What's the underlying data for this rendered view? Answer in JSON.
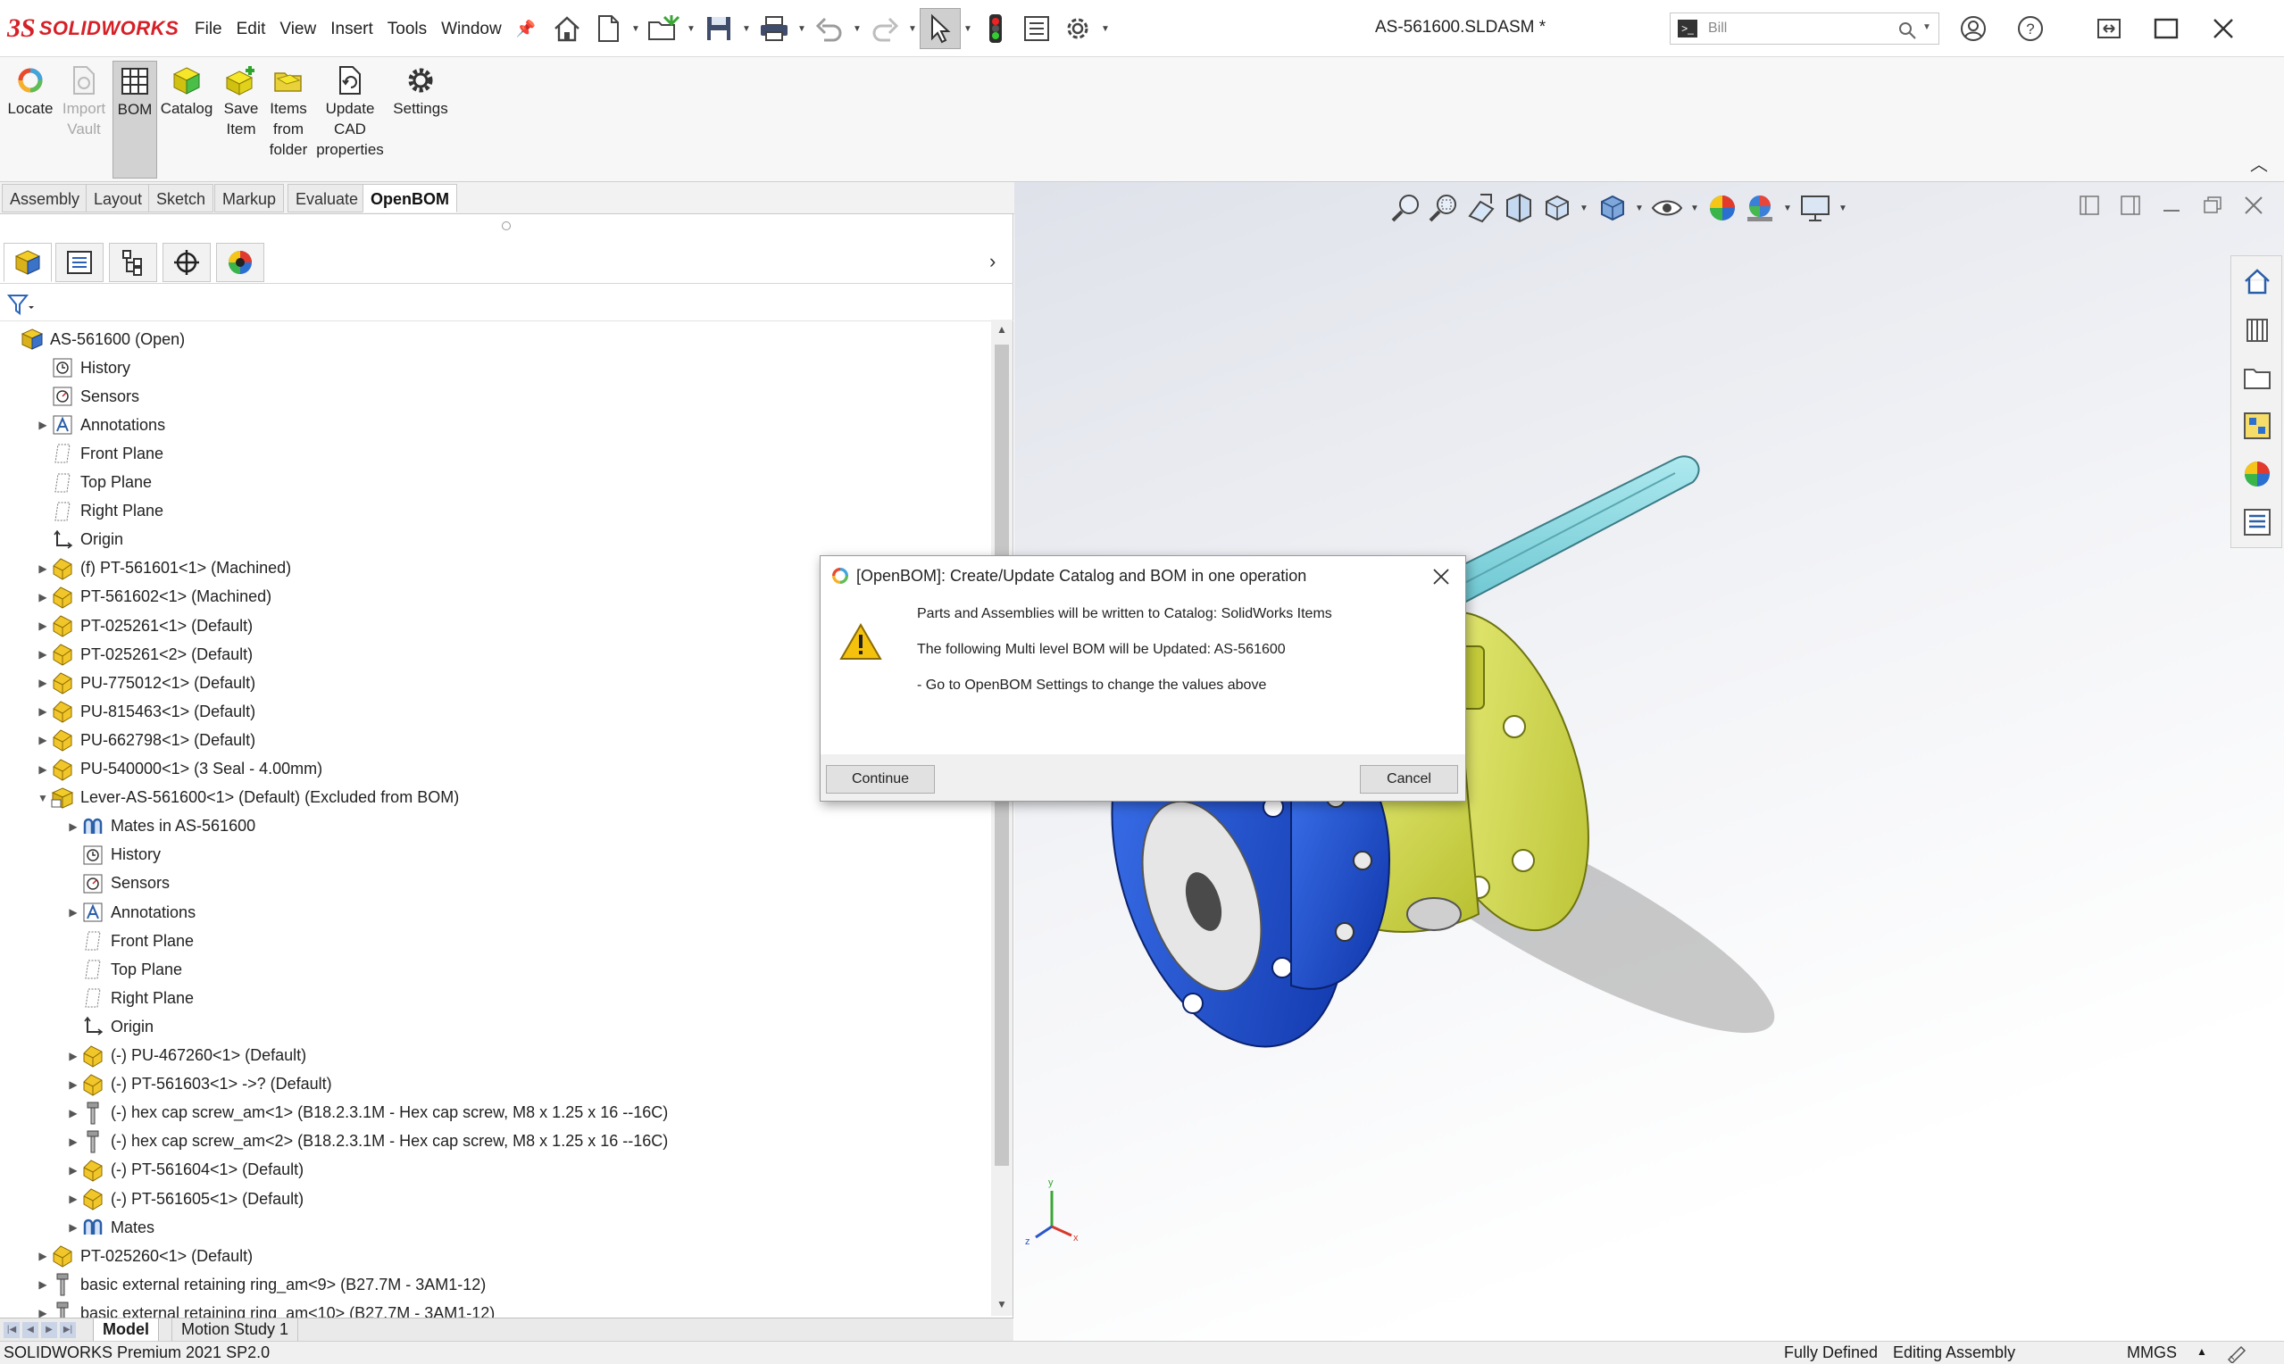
{
  "app": {
    "brand": "SOLIDWORKS",
    "menus": [
      "File",
      "Edit",
      "View",
      "Insert",
      "Tools",
      "Window"
    ],
    "document_title": "AS-561600.SLDASM *",
    "search_value": "Bill"
  },
  "ribbon": {
    "locate": "Locate",
    "import_vault_1": "Import",
    "import_vault_2": "Vault",
    "bom": "BOM",
    "catalog": "Catalog",
    "save_item_1": "Save",
    "save_item_2": "Item",
    "items_folder_1": "Items",
    "items_folder_2": "from",
    "items_folder_3": "folder",
    "update_cad_1": "Update",
    "update_cad_2": "CAD",
    "update_cad_3": "properties",
    "settings": "Settings"
  },
  "tabs": [
    "Assembly",
    "Layout",
    "Sketch",
    "Markup",
    "Evaluate",
    "OpenBOM"
  ],
  "tree": [
    {
      "text": "AS-561600  (Open)",
      "indent": 0,
      "icon": "assembly-icon",
      "exp": ""
    },
    {
      "text": "History",
      "indent": 1,
      "icon": "history-icon",
      "exp": ""
    },
    {
      "text": "Sensors",
      "indent": 1,
      "icon": "sensors-icon",
      "exp": ""
    },
    {
      "text": "Annotations",
      "indent": 1,
      "icon": "annotations-icon",
      "exp": "▶"
    },
    {
      "text": "Front Plane",
      "indent": 1,
      "icon": "plane-icon",
      "exp": ""
    },
    {
      "text": "Top Plane",
      "indent": 1,
      "icon": "plane-icon",
      "exp": ""
    },
    {
      "text": "Right Plane",
      "indent": 1,
      "icon": "plane-icon",
      "exp": ""
    },
    {
      "text": "Origin",
      "indent": 1,
      "icon": "origin-icon",
      "exp": ""
    },
    {
      "text": "(f) PT-561601<1> (Machined)",
      "indent": 1,
      "icon": "part-icon",
      "exp": "▶"
    },
    {
      "text": "PT-561602<1> (Machined)",
      "indent": 1,
      "icon": "part-icon",
      "exp": "▶"
    },
    {
      "text": "PT-025261<1> (Default)",
      "indent": 1,
      "icon": "part-icon",
      "exp": "▶"
    },
    {
      "text": "PT-025261<2> (Default)",
      "indent": 1,
      "icon": "part-icon",
      "exp": "▶"
    },
    {
      "text": "PU-775012<1> (Default)",
      "indent": 1,
      "icon": "part-icon",
      "exp": "▶"
    },
    {
      "text": "PU-815463<1> (Default)",
      "indent": 1,
      "icon": "part-icon",
      "exp": "▶"
    },
    {
      "text": "PU-662798<1> (Default)",
      "indent": 1,
      "icon": "part-icon",
      "exp": "▶"
    },
    {
      "text": "PU-540000<1> (3 Seal - 4.00mm)",
      "indent": 1,
      "icon": "part-icon",
      "exp": "▶"
    },
    {
      "text": "Lever-AS-561600<1> (Default) (Excluded from BOM)",
      "indent": 1,
      "icon": "subassembly-icon",
      "exp": "▼"
    },
    {
      "text": "Mates in AS-561600",
      "indent": 2,
      "icon": "mates-icon",
      "exp": "▶"
    },
    {
      "text": "History",
      "indent": 2,
      "icon": "history-icon",
      "exp": ""
    },
    {
      "text": "Sensors",
      "indent": 2,
      "icon": "sensors-icon",
      "exp": ""
    },
    {
      "text": "Annotations",
      "indent": 2,
      "icon": "annotations-icon",
      "exp": "▶"
    },
    {
      "text": "Front Plane",
      "indent": 2,
      "icon": "plane-icon",
      "exp": ""
    },
    {
      "text": "Top Plane",
      "indent": 2,
      "icon": "plane-icon",
      "exp": ""
    },
    {
      "text": "Right Plane",
      "indent": 2,
      "icon": "plane-icon",
      "exp": ""
    },
    {
      "text": "Origin",
      "indent": 2,
      "icon": "origin-icon",
      "exp": ""
    },
    {
      "text": "(-) PU-467260<1> (Default)",
      "indent": 2,
      "icon": "part-icon",
      "exp": "▶"
    },
    {
      "text": "(-) PT-561603<1> ->? (Default)",
      "indent": 2,
      "icon": "part-icon",
      "exp": "▶"
    },
    {
      "text": "(-) hex cap screw_am<1> (B18.2.3.1M - Hex cap screw, M8 x 1.25 x 16 --16C)",
      "indent": 2,
      "icon": "screw-icon",
      "exp": "▶"
    },
    {
      "text": "(-) hex cap screw_am<2> (B18.2.3.1M - Hex cap screw, M8 x 1.25 x 16 --16C)",
      "indent": 2,
      "icon": "screw-icon",
      "exp": "▶"
    },
    {
      "text": "(-) PT-561604<1> (Default)",
      "indent": 2,
      "icon": "part-icon",
      "exp": "▶"
    },
    {
      "text": "(-) PT-561605<1> (Default)",
      "indent": 2,
      "icon": "part-icon",
      "exp": "▶"
    },
    {
      "text": "Mates",
      "indent": 2,
      "icon": "mates-icon",
      "exp": "▶"
    },
    {
      "text": "PT-025260<1> (Default)",
      "indent": 1,
      "icon": "part-icon",
      "exp": "▶"
    },
    {
      "text": "basic external retaining ring_am<9> (B27.7M - 3AM1-12)",
      "indent": 1,
      "icon": "screw-icon",
      "exp": "▶"
    },
    {
      "text": "basic external retaining ring_am<10> (B27.7M - 3AM1-12)",
      "indent": 1,
      "icon": "screw-icon",
      "exp": "▶"
    }
  ],
  "bottom_tabs": [
    "Model",
    "Motion Study 1"
  ],
  "status": {
    "product": "SOLIDWORKS Premium 2021 SP2.0",
    "defined": "Fully Defined",
    "mode": "Editing Assembly",
    "units": "MMGS"
  },
  "dialog": {
    "title": "[OpenBOM]: Create/Update Catalog and BOM in one operation",
    "line1": "Parts and Assemblies will be written to Catalog: SolidWorks Items",
    "line2": "The following Multi level BOM will be Updated: AS-561600",
    "line3": "- Go to OpenBOM Settings to change the values above",
    "continue": "Continue",
    "cancel": "Cancel"
  },
  "colors": {
    "accent": "#d62027",
    "part_yellow": "#f0c419",
    "flange_blue": "#1f52d8",
    "body_green": "#e4ef6a",
    "lever_cyan": "#86d6df"
  }
}
